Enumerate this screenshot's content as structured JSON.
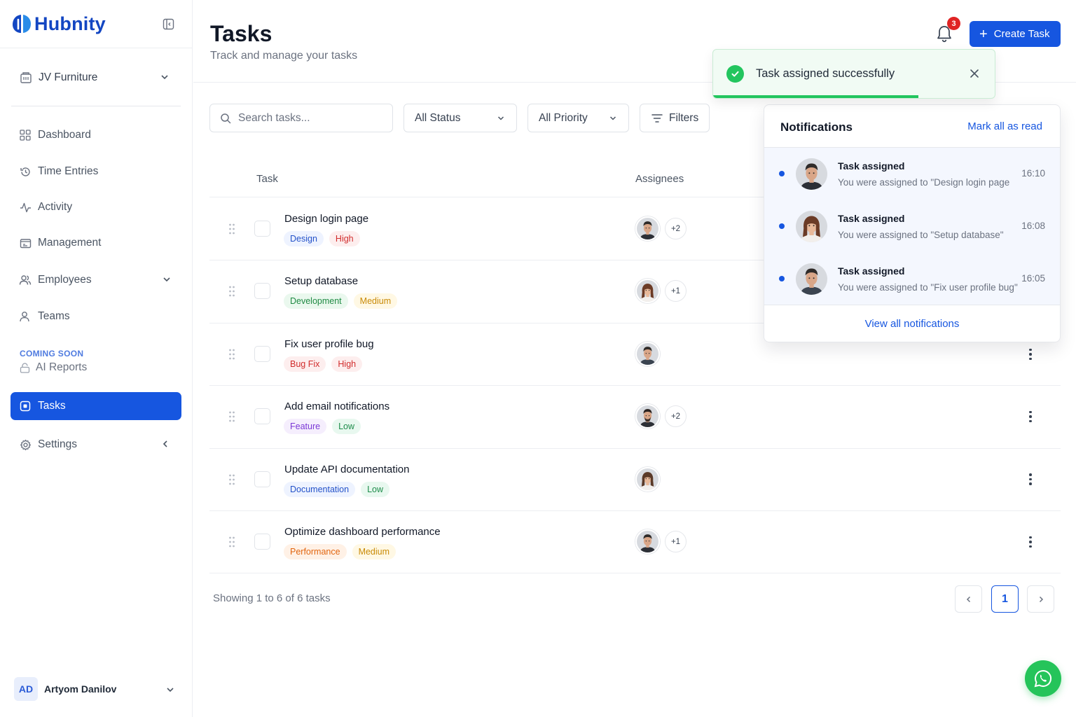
{
  "app": {
    "name": "Hubnity",
    "brand_color": "#1346c2",
    "accent_color": "#1656e0"
  },
  "sidebar": {
    "organization": "JV Furniture",
    "items": [
      {
        "label": "Dashboard",
        "icon": "grid-icon"
      },
      {
        "label": "Time Entries",
        "icon": "history-icon"
      },
      {
        "label": "Activity",
        "icon": "activity-icon"
      },
      {
        "label": "Management",
        "icon": "management-icon"
      },
      {
        "label": "Employees",
        "icon": "users-icon"
      },
      {
        "label": "Teams",
        "icon": "user-icon"
      }
    ],
    "coming_soon_label": "COMING SOON",
    "ai_reports": "AI Reports",
    "active_item": "Tasks",
    "settings": "Settings",
    "user": {
      "initials": "AD",
      "name": "Artyom Danilov"
    }
  },
  "header": {
    "title": "Tasks",
    "subtitle": "Track and manage your tasks",
    "notification_count": "3",
    "create_button": "Create Task"
  },
  "toolbar": {
    "search_placeholder": "Search tasks...",
    "status_filter": "All Status",
    "priority_filter": "All Priority",
    "filters_button": "Filters"
  },
  "table": {
    "columns": [
      "Task",
      "Assignees"
    ],
    "rows": [
      {
        "name": "Design login page",
        "tags": [
          {
            "label": "Design",
            "style": "blue"
          },
          {
            "label": "High",
            "style": "red"
          }
        ],
        "avatar": "man-1",
        "extra": "+2"
      },
      {
        "name": "Setup database",
        "tags": [
          {
            "label": "Development",
            "style": "green"
          },
          {
            "label": "Medium",
            "style": "yellow"
          }
        ],
        "avatar": "woman-1",
        "extra": "+1"
      },
      {
        "name": "Fix user profile bug",
        "tags": [
          {
            "label": "Bug Fix",
            "style": "red"
          },
          {
            "label": "High",
            "style": "red"
          }
        ],
        "avatar": "man-2",
        "extra": ""
      },
      {
        "name": "Add email notifications",
        "tags": [
          {
            "label": "Feature",
            "style": "purple"
          },
          {
            "label": "Low",
            "style": "teal"
          }
        ],
        "avatar": "man-3",
        "extra": "+2"
      },
      {
        "name": "Update API documentation",
        "tags": [
          {
            "label": "Documentation",
            "style": "blue"
          },
          {
            "label": "Low",
            "style": "teal"
          }
        ],
        "avatar": "woman-2",
        "extra": ""
      },
      {
        "name": "Optimize dashboard performance",
        "tags": [
          {
            "label": "Performance",
            "style": "orange"
          },
          {
            "label": "Medium",
            "style": "yellow"
          }
        ],
        "avatar": "man-1",
        "extra": "+1"
      }
    ]
  },
  "pagination": {
    "summary": "Showing 1 to 6 of 6 tasks",
    "current_page": "1"
  },
  "toast": {
    "message": "Task assigned successfully",
    "progress": 0.73,
    "color": "#22c55e"
  },
  "notifications": {
    "title": "Notifications",
    "mark_all": "Mark all as read",
    "items": [
      {
        "title": "Task assigned",
        "body": "You were assigned to \"Design login page",
        "time": "16:10",
        "avatar": "man-1"
      },
      {
        "title": "Task assigned",
        "body": "You were assigned to \"Setup database\"",
        "time": "16:08",
        "avatar": "woman-1"
      },
      {
        "title": "Task assigned",
        "body": "You were assigned to \"Fix user profile bug\"",
        "time": "16:05",
        "avatar": "man-2"
      }
    ],
    "view_all": "View all notifications"
  }
}
